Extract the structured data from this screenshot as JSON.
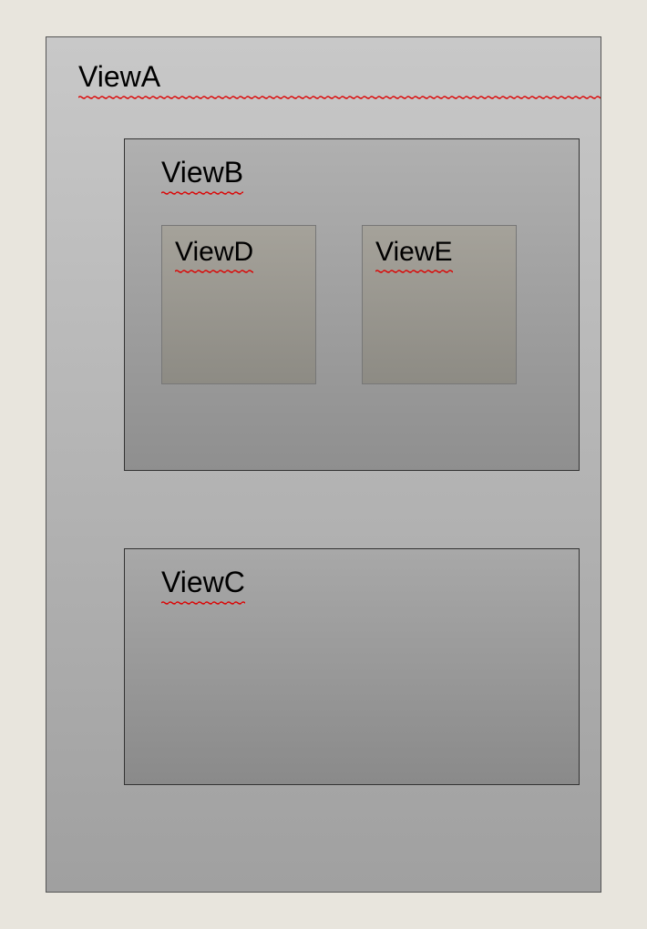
{
  "viewA": {
    "label": "ViewA",
    "children": {
      "viewB": {
        "label": "ViewB",
        "children": {
          "viewD": {
            "label": "ViewD"
          },
          "viewE": {
            "label": "ViewE"
          }
        }
      },
      "viewC": {
        "label": "ViewC"
      }
    }
  }
}
